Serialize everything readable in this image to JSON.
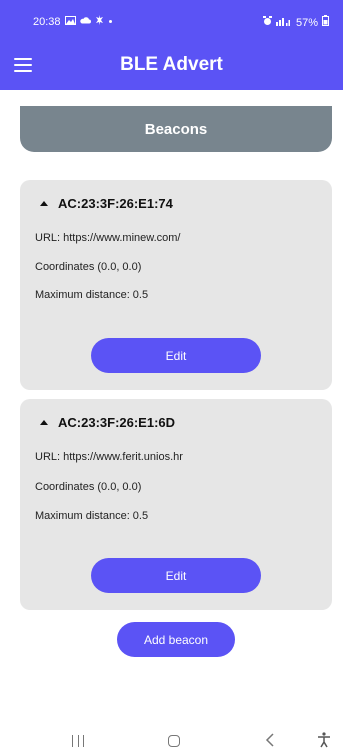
{
  "status_bar": {
    "time": "20:38",
    "icons_left": [
      "gallery-icon",
      "cloud-icon",
      "settings-icon",
      "dot-icon"
    ],
    "battery": "57%",
    "icons_right": [
      "alarm-icon",
      "signal-icon",
      "battery-icon"
    ]
  },
  "app_bar": {
    "title": "BLE Advert",
    "color": "#5b53f5"
  },
  "section_tab": {
    "label": "Beacons",
    "color": "#78858e"
  },
  "beacons": [
    {
      "mac": "AC:23:3F:26:E1:74",
      "url": "URL: https://www.minew.com/",
      "coordinates": "Coordinates (0.0, 0.0)",
      "max_distance": "Maximum distance: 0.5",
      "edit_label": "Edit"
    },
    {
      "mac": "AC:23:3F:26:E1:6D",
      "url": "URL: https://www.ferit.unios.hr",
      "coordinates": "Coordinates (0.0, 0.0)",
      "max_distance": "Maximum distance: 0.5",
      "edit_label": "Edit"
    }
  ],
  "add_button_label": "Add beacon",
  "nav_bar": {
    "buttons": [
      "recents-icon",
      "home-icon",
      "back-icon",
      "accessibility-icon"
    ]
  }
}
